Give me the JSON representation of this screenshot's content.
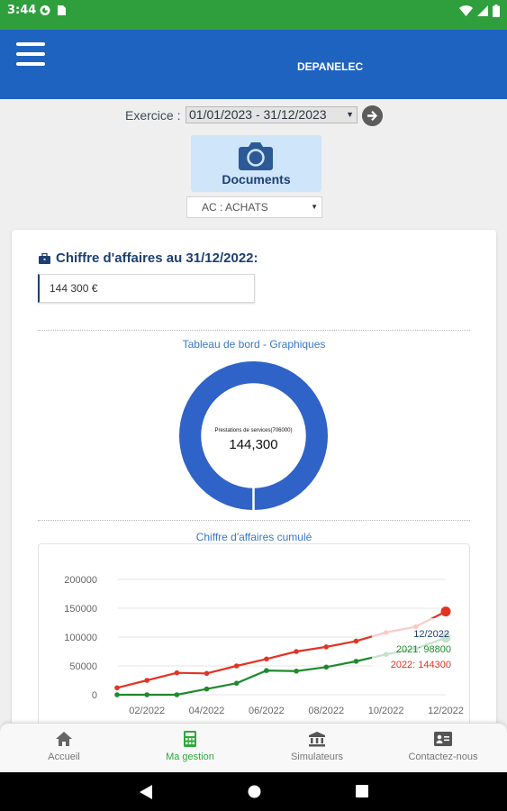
{
  "status_bar": {
    "time": "3:44"
  },
  "app_bar": {
    "title": "DEPANELEC"
  },
  "exercice": {
    "label": "Exercice :",
    "selected": "01/01/2023 - 31/12/2023"
  },
  "documents_button": {
    "label": "Documents"
  },
  "journal_select": {
    "selected": "AC : ACHATS"
  },
  "card": {
    "ca_title": "Chiffre d'affaires au 31/12/2022:",
    "ca_value": "144 300 €",
    "dashboard_title": "Tableau de bord - Graphiques",
    "donut_center_label": "Prestations de services(706000)",
    "donut_center_value": "144,300",
    "cumul_title": "Chiffre d'affaires cumulé"
  },
  "colors": {
    "primary": "#1f63c0",
    "green": "#2e9f3c",
    "series_2022": "#e03424",
    "series_2021": "#1e8a2c",
    "donut": "#2f63c7"
  },
  "chart_data": {
    "type": "line",
    "title": "Chiffre d'affaires cumulé",
    "x": [
      "01/2022",
      "02/2022",
      "03/2022",
      "04/2022",
      "05/2022",
      "06/2022",
      "07/2022",
      "08/2022",
      "09/2022",
      "10/2022",
      "11/2022",
      "12/2022"
    ],
    "x_tick_labels": [
      "02/2022",
      "04/2022",
      "06/2022",
      "08/2022",
      "10/2022",
      "12/2022"
    ],
    "y_ticks": [
      "0",
      "50000",
      "100000",
      "150000",
      "200000"
    ],
    "ylim": [
      0,
      200000
    ],
    "grid": true,
    "series": [
      {
        "name": "2022",
        "color": "#e03424",
        "values": [
          12000,
          25000,
          38000,
          37000,
          50000,
          62000,
          75000,
          83000,
          93000,
          108000,
          118000,
          144300
        ]
      },
      {
        "name": "2021",
        "color": "#1e8a2c",
        "values": [
          0,
          0,
          0,
          10000,
          20000,
          42000,
          41000,
          48000,
          58000,
          70000,
          80000,
          98800
        ]
      }
    ],
    "tooltip": {
      "header": "12/2022",
      "line_2021": "2021: 98800",
      "line_2022": "2022: 144300"
    }
  },
  "bottom_nav": [
    {
      "label": "Accueil",
      "icon": "home-icon",
      "active": false
    },
    {
      "label": "Ma gestion",
      "icon": "calculator-icon",
      "active": true
    },
    {
      "label": "Simulateurs",
      "icon": "bank-icon",
      "active": false
    },
    {
      "label": "Contactez-nous",
      "icon": "contact-card-icon",
      "active": false
    }
  ]
}
